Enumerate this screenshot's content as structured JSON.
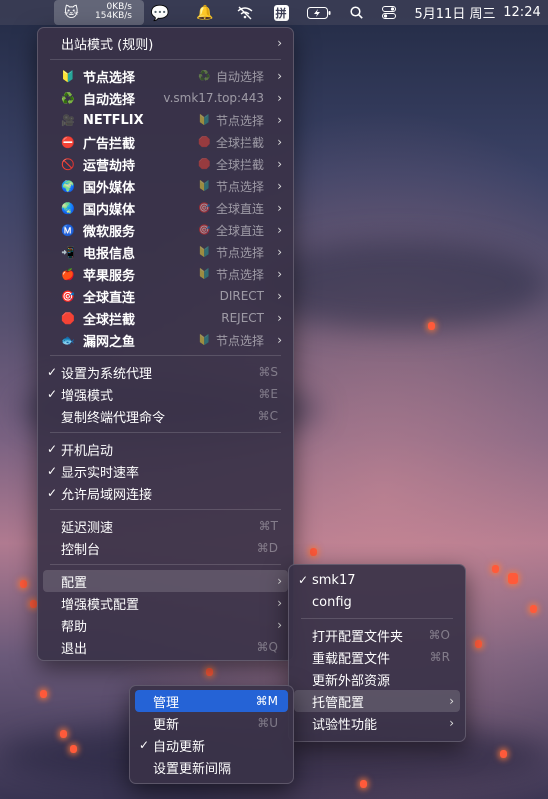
{
  "menubar": {
    "speed_up": "0KB/s",
    "speed_down": "154KB/s",
    "date": "5月11日 周三",
    "time": "12:24",
    "input_method": "拼",
    "icons": [
      "cat-icon",
      "wechat-icon",
      "notification-icon",
      "wifi-off-icon",
      "input-method-icon",
      "battery-icon",
      "search-icon",
      "control-center-icon"
    ]
  },
  "main_menu": {
    "outbound_mode": "出站模式 (规则)",
    "proxies": [
      {
        "icon": "🔰",
        "name": "节点选择",
        "value_icon": "♻️",
        "value": "自动选择"
      },
      {
        "icon": "♻️",
        "name": "自动选择",
        "value_icon": "",
        "value": "v.smk17.top:443"
      },
      {
        "icon": "🎥",
        "name": "NETFLIX",
        "value_icon": "🔰",
        "value": "节点选择"
      },
      {
        "icon": "⛔",
        "name": "广告拦截",
        "value_icon": "🛑",
        "value": "全球拦截"
      },
      {
        "icon": "🚫",
        "name": "运营劫持",
        "value_icon": "🛑",
        "value": "全球拦截"
      },
      {
        "icon": "🌍",
        "name": "国外媒体",
        "value_icon": "🔰",
        "value": "节点选择"
      },
      {
        "icon": "🌏",
        "name": "国内媒体",
        "value_icon": "🎯",
        "value": "全球直连"
      },
      {
        "icon": "Ⓜ️",
        "name": "微软服务",
        "value_icon": "🎯",
        "value": "全球直连"
      },
      {
        "icon": "📲",
        "name": "电报信息",
        "value_icon": "🔰",
        "value": "节点选择"
      },
      {
        "icon": "🍎",
        "name": "苹果服务",
        "value_icon": "🔰",
        "value": "节点选择"
      },
      {
        "icon": "🎯",
        "name": "全球直连",
        "value_icon": "",
        "value": "DIRECT"
      },
      {
        "icon": "🛑",
        "name": "全球拦截",
        "value_icon": "",
        "value": "REJECT"
      },
      {
        "icon": "🐟",
        "name": "漏网之鱼",
        "value_icon": "🔰",
        "value": "节点选择"
      }
    ],
    "set_system_proxy": "设置为系统代理",
    "set_system_proxy_sc": "⌘S",
    "enhanced_mode": "增强模式",
    "enhanced_mode_sc": "⌘E",
    "copy_shell": "复制终端代理命令",
    "copy_shell_sc": "⌘C",
    "launch_at_login": "开机启动",
    "show_speed": "显示实时速率",
    "allow_lan": "允许局域网连接",
    "latency_test": "延迟测速",
    "latency_test_sc": "⌘T",
    "dashboard": "控制台",
    "dashboard_sc": "⌘D",
    "config": "配置",
    "enhanced_config": "增强模式配置",
    "help": "帮助",
    "quit": "退出",
    "quit_sc": "⌘Q",
    "check": "✓",
    "arrow": "›"
  },
  "config_menu": {
    "profile_1": "smk17",
    "profile_2": "config",
    "open_folder": "打开配置文件夹",
    "open_folder_sc": "⌘O",
    "reload": "重载配置文件",
    "reload_sc": "⌘R",
    "update_external": "更新外部资源",
    "hosted_config": "托管配置",
    "experimental": "试验性功能"
  },
  "hosted_menu": {
    "manage": "管理",
    "manage_sc": "⌘M",
    "update": "更新",
    "update_sc": "⌘U",
    "auto_update": "自动更新",
    "update_interval": "设置更新间隔"
  }
}
